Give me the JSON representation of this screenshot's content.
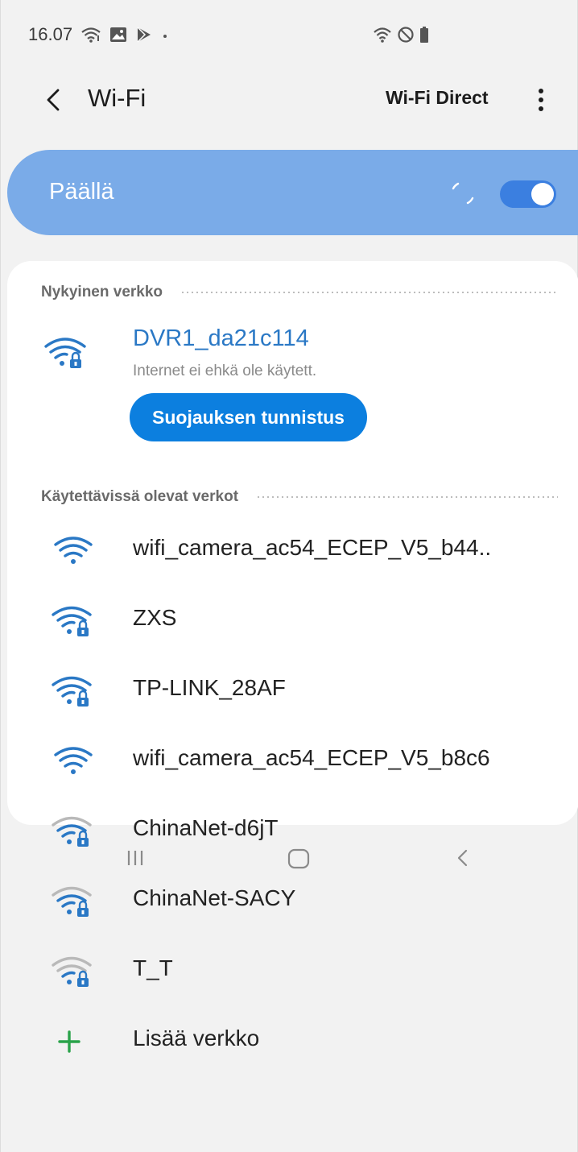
{
  "status_bar": {
    "time": "16.07"
  },
  "header": {
    "title": "Wi-Fi",
    "wifi_direct_label": "Wi-Fi Direct"
  },
  "toggle": {
    "label": "Päällä",
    "state": "on",
    "accent_color": "#3b7fe0"
  },
  "current_section": {
    "title": "Nykyinen verkko",
    "network": {
      "name": "DVR1_da21c114",
      "status": "Internet ei ehkä ole käytett.",
      "button_label": "Suojauksen tunnistus"
    }
  },
  "available_section": {
    "title": "Käytettävissä olevat verkot",
    "networks": [
      {
        "name": "wifi_camera_ac54_ECEP_V5_b44..",
        "secured": false,
        "strength": "strong"
      },
      {
        "name": "ZXS",
        "secured": true,
        "strength": "strong"
      },
      {
        "name": "TP-LINK_28AF",
        "secured": true,
        "strength": "strong"
      },
      {
        "name": "wifi_camera_ac54_ECEP_V5_b8c6",
        "secured": false,
        "strength": "strong"
      },
      {
        "name": "ChinaNet-d6jT",
        "secured": true,
        "strength": "medium"
      },
      {
        "name": "ChinaNet-SACY",
        "secured": true,
        "strength": "medium"
      },
      {
        "name": "T_T",
        "secured": true,
        "strength": "weak"
      }
    ],
    "add_network_label": "Lisää verkko"
  },
  "colors": {
    "accent_blue": "#2a78c5",
    "button_blue": "#0c7fdf",
    "toggle_bar": "#7aabe8",
    "add_green": "#2aa34a"
  },
  "nav_icons": [
    "recents-icon",
    "home-icon",
    "back-icon"
  ]
}
